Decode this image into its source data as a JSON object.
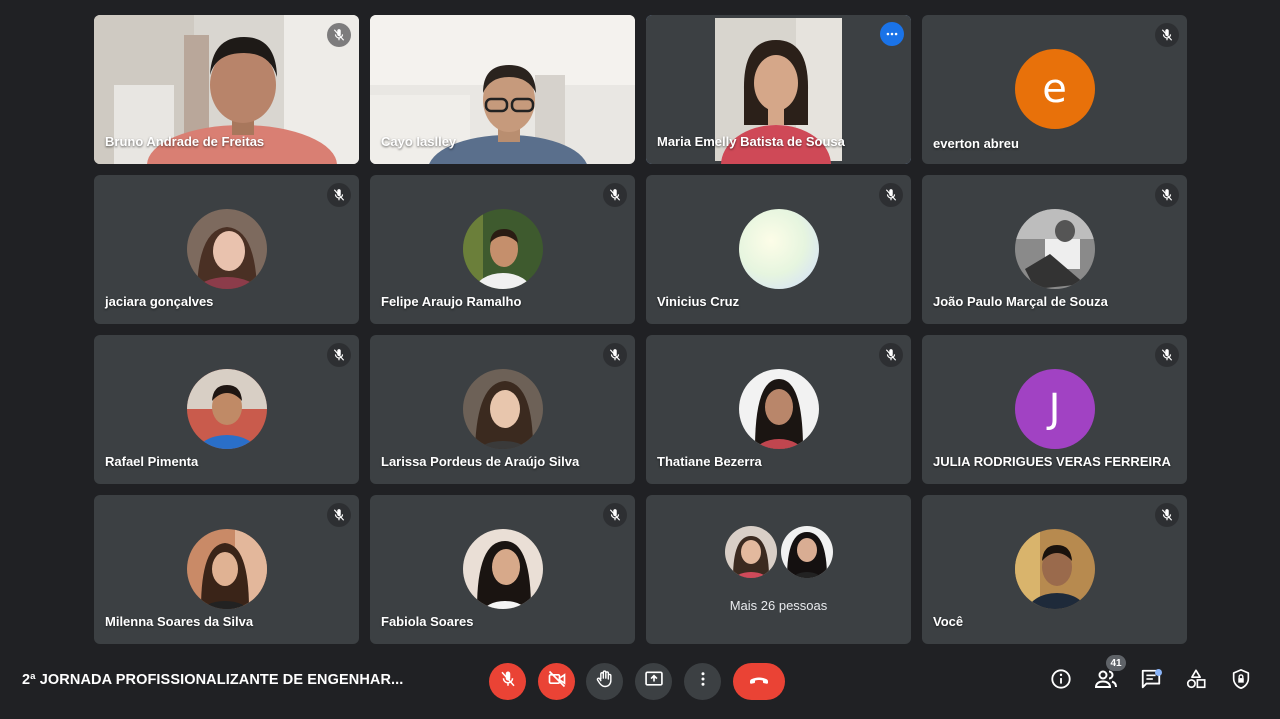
{
  "participants": [
    {
      "name": "Bruno Andrade de Freitas",
      "type": "video",
      "muted": true
    },
    {
      "name": "Cayo Iaslley",
      "type": "video",
      "muted": false
    },
    {
      "name": "Maria Emelly Batista de Sousa",
      "type": "video",
      "muted": false,
      "speaking": true,
      "options_icon": "more-horiz-icon"
    },
    {
      "name": "everton abreu",
      "type": "letter",
      "letter": "e",
      "color": "#e8710a",
      "muted": true
    },
    {
      "name": "jaciara gonçalves",
      "type": "photo",
      "muted": true
    },
    {
      "name": "Felipe Araujo Ramalho",
      "type": "photo",
      "muted": true
    },
    {
      "name": "Vinicius Cruz",
      "type": "photo",
      "muted": true
    },
    {
      "name": "João Paulo Marçal de Souza",
      "type": "photo",
      "muted": true
    },
    {
      "name": "Rafael Pimenta",
      "type": "photo",
      "muted": true
    },
    {
      "name": "Larissa Pordeus de Araújo Silva",
      "type": "photo",
      "muted": true
    },
    {
      "name": "Thatiane Bezerra",
      "type": "photo",
      "muted": true
    },
    {
      "name": "JULIA RODRIGUES VERAS FERREIRA",
      "type": "letter",
      "letter": "J",
      "color": "#a142c3",
      "muted": true
    },
    {
      "name": "Milenna Soares da Silva",
      "type": "photo",
      "muted": true
    },
    {
      "name": "Fabiola Soares",
      "type": "photo",
      "muted": true
    },
    {
      "name": "Mais 26 pessoas",
      "type": "more"
    },
    {
      "name": "Você",
      "type": "photo",
      "muted": true
    }
  ],
  "meeting": {
    "title": "2ª JORNADA PROFISSIONALIZANTE DE ENGENHAR...",
    "participant_count": "41"
  },
  "controls": [
    "mic-off-icon",
    "camera-off-icon",
    "raise-hand-icon",
    "present-screen-icon",
    "more-vert-icon",
    "hang-up-icon"
  ],
  "right_controls": [
    "info-icon",
    "people-icon",
    "chat-icon",
    "activities-icon",
    "host-controls-icon"
  ],
  "colors": {
    "background": "#202124",
    "tile": "#3c4043",
    "accent": "#1a73e8",
    "danger": "#ea4335"
  }
}
